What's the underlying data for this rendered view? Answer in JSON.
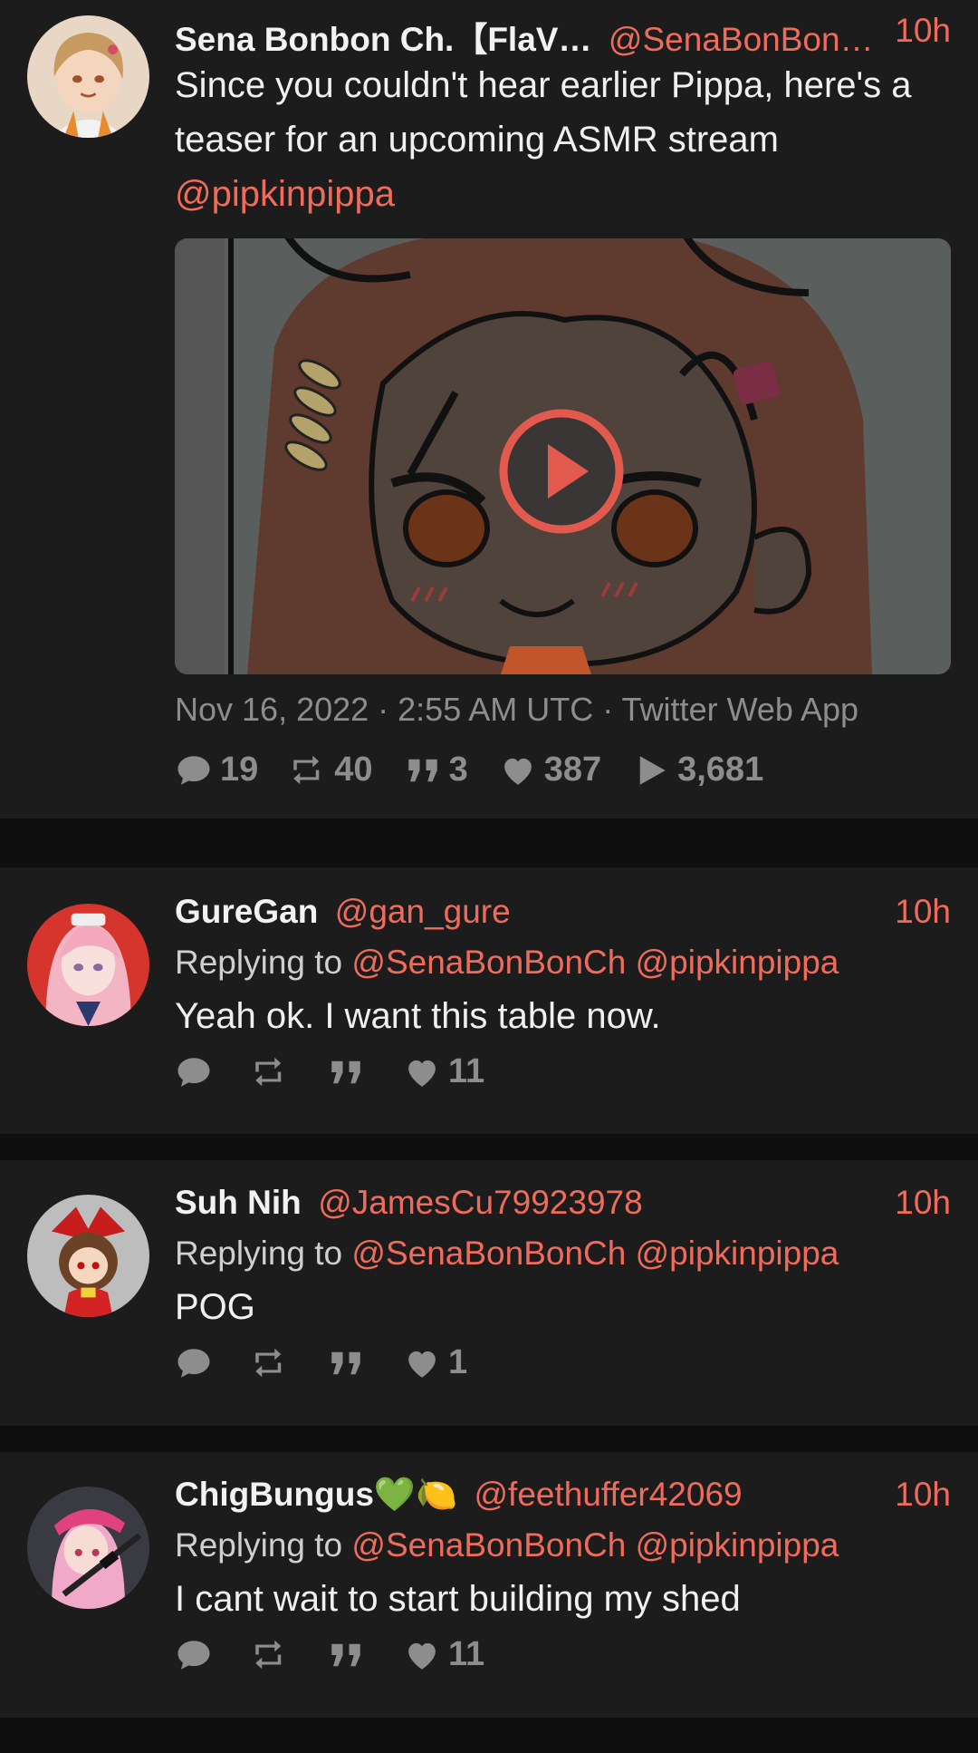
{
  "main_tweet": {
    "display_name": "Sena Bonbon Ch.【FlaV…",
    "handle": "@SenaBonBon…",
    "time": "10h",
    "text": "Since you couldn't hear earlier Pippa, here's a teaser for an upcoming ASMR stream",
    "mention": "@pipkinpippa",
    "meta": "Nov 16, 2022 · 2:55 AM UTC · Twitter Web App",
    "stats": {
      "replies": "19",
      "retweets": "40",
      "quotes": "3",
      "likes": "387",
      "views": "3,681"
    }
  },
  "replies": [
    {
      "display_name": "GureGan",
      "handle": "@gan_gure",
      "time": "10h",
      "replying_label": "Replying to",
      "replying_to": [
        "@SenaBonBonCh",
        "@pipkinpippa"
      ],
      "text": "Yeah ok. I want this table now.",
      "likes": "11"
    },
    {
      "display_name": "Suh Nih",
      "handle": "@JamesCu79923978",
      "time": "10h",
      "replying_label": "Replying to",
      "replying_to": [
        "@SenaBonBonCh",
        "@pipkinpippa"
      ],
      "text": "POG",
      "likes": "1"
    },
    {
      "display_name": "ChigBungus💚🍋",
      "handle": "@feethuffer42069",
      "time": "10h",
      "replying_label": "Replying to",
      "replying_to": [
        "@SenaBonBonCh",
        "@pipkinpippa"
      ],
      "text": "I cant wait to start building my shed",
      "likes": "11"
    }
  ],
  "colors": {
    "accent": "#ef6b5c",
    "background": "#0f0f0f",
    "card": "#1c1c1c",
    "muted": "#8d8d8d"
  },
  "icons": [
    "comment-icon",
    "retweet-icon",
    "quote-icon",
    "heart-icon",
    "play-icon"
  ]
}
